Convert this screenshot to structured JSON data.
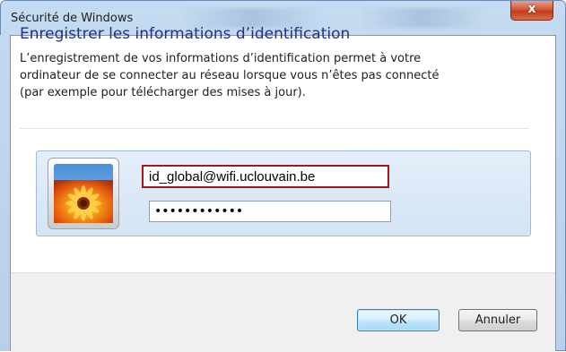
{
  "window": {
    "title": "Sécurité de Windows",
    "close_label": "x"
  },
  "dialog": {
    "heading": "Enregistrer les informations d’identification",
    "description_lines": [
      "L’enregistrement de vos informations d’identification permet à votre",
      "ordinateur de se connecter au réseau lorsque vous n’êtes pas connecté",
      "(par exemple pour télécharger des mises à jour)."
    ]
  },
  "credentials": {
    "avatar_icon": "flower-user-tile-icon",
    "username_value": "id_global@wifi.uclouvain.be",
    "password_masked": "••••••••••••"
  },
  "buttons": {
    "ok_label": "OK",
    "cancel_label": "Annuler"
  },
  "colors": {
    "heading": "#1e3287",
    "highlight_border": "#a1171d",
    "close_button": "#c23d1b",
    "window_frame": "#b9d1ea"
  }
}
